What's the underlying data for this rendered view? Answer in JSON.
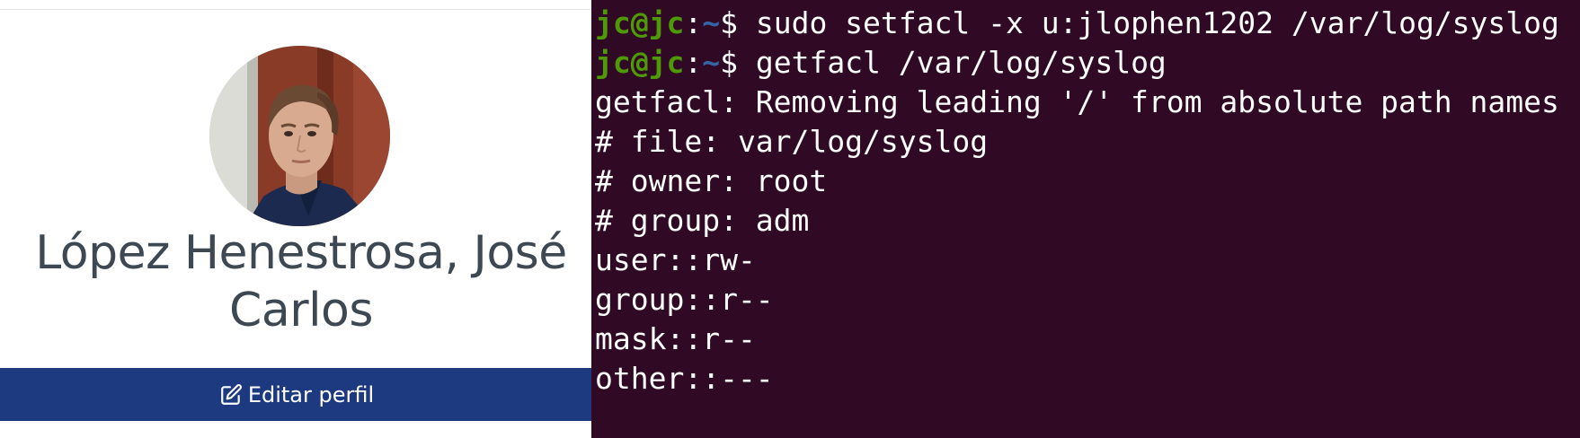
{
  "profile": {
    "name_line1": "López Henestrosa, José",
    "name_line2": "Carlos",
    "edit_button_label": "Editar perfil",
    "edit_icon": "edit-icon",
    "button_color": "#1d3a80"
  },
  "terminal": {
    "background": "#300a24",
    "prompt": {
      "user_host": "jc@jc",
      "colon": ":",
      "path": "~",
      "dollar": "$ "
    },
    "commands": [
      "sudo setfacl -x u:jlophen1202 /var/log/syslog",
      "getfacl /var/log/syslog"
    ],
    "output": [
      "getfacl: Removing leading '/' from absolute path names",
      "# file: var/log/syslog",
      "# owner: root",
      "# group: adm",
      "user::rw-",
      "group::r--",
      "mask::r--",
      "other::---"
    ]
  }
}
